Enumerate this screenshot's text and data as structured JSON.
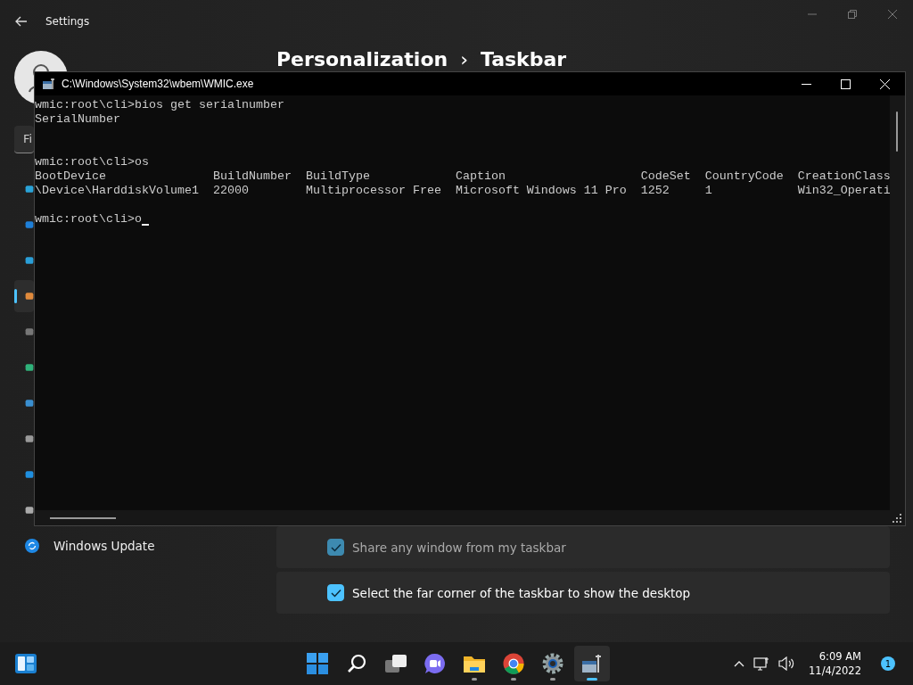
{
  "settings": {
    "title": "Settings",
    "search": {
      "placeholder": "Fi"
    },
    "sidebar": {
      "items": [
        {
          "kind": "system",
          "selected": false
        },
        {
          "kind": "bluetooth",
          "selected": false
        },
        {
          "kind": "network",
          "selected": false
        },
        {
          "kind": "personalization",
          "selected": true
        },
        {
          "kind": "apps",
          "selected": false
        },
        {
          "kind": "accounts",
          "selected": false
        },
        {
          "kind": "time",
          "selected": false
        },
        {
          "kind": "gaming",
          "selected": false
        },
        {
          "kind": "accessibility",
          "selected": false
        },
        {
          "kind": "privacy",
          "selected": false
        },
        {
          "kind": "update",
          "selected": false,
          "label": "Windows Update"
        }
      ]
    },
    "breadcrumb": {
      "items": [
        "Personalization",
        "Taskbar"
      ],
      "separator": "›"
    },
    "options": [
      {
        "label": "Share any window from my taskbar",
        "checked": true,
        "disabled": true
      },
      {
        "label": "Select the far corner of the taskbar to show the desktop",
        "checked": true,
        "disabled": false
      }
    ]
  },
  "console": {
    "title": "C:\\Windows\\System32\\wbem\\WMIC.exe",
    "lines": [
      {
        "kind": "text",
        "text": "wmic:root\\cli>bios get serialnumber"
      },
      {
        "kind": "text",
        "text": "SerialNumber"
      },
      {
        "kind": "blank"
      },
      {
        "kind": "blank"
      },
      {
        "kind": "text",
        "text": "wmic:root\\cli>os"
      },
      {
        "kind": "text",
        "text": "BootDevice               BuildNumber  BuildType            Caption                   CodeSet  CountryCode  CreationClass"
      },
      {
        "kind": "text",
        "text": "\\Device\\HarddiskVolume1  22000        Multiprocessor Free  Microsoft Windows 11 Pro  1252     1            Win32_Operati"
      },
      {
        "kind": "blank"
      },
      {
        "kind": "prompt",
        "text": "wmic:root\\cli>o"
      }
    ]
  },
  "taskbar": {
    "apps": [
      {
        "kind": "start",
        "running": false,
        "active": false
      },
      {
        "kind": "search",
        "running": false,
        "active": false
      },
      {
        "kind": "taskview",
        "running": false,
        "active": false
      },
      {
        "kind": "chat",
        "running": false,
        "active": false
      },
      {
        "kind": "explorer",
        "running": true,
        "active": false
      },
      {
        "kind": "browser",
        "running": true,
        "active": false
      },
      {
        "kind": "settings",
        "running": true,
        "active": false
      },
      {
        "kind": "console",
        "running": true,
        "active": true
      }
    ],
    "time": "6:09 AM",
    "date": "11/4/2022",
    "notifications": "1"
  }
}
